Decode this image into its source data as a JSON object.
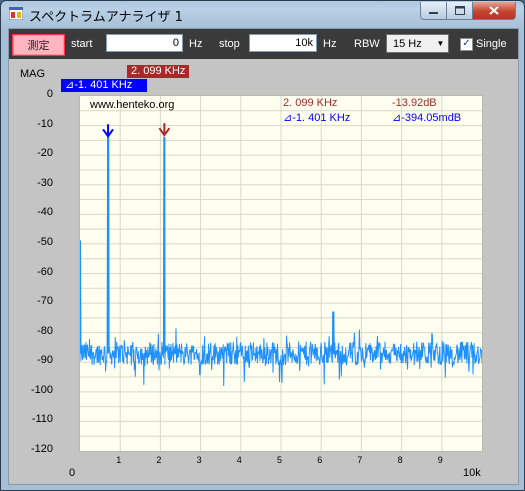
{
  "window": {
    "title": "スペクトラムアナライザ 1"
  },
  "toolbar": {
    "measure_label": "測定",
    "start_label": "start",
    "start_value": "0",
    "start_unit": "Hz",
    "stop_label": "stop",
    "stop_value": "10k",
    "stop_unit": "Hz",
    "rbw_label": "RBW",
    "rbw_selected": "15 Hz",
    "single_label": "Single",
    "single_checked": true
  },
  "plot": {
    "y_axis_label": "MAG",
    "marker1_readout": "2. 099 KHz",
    "marker2_readout": "⊿-1. 401 KHz",
    "watermark": "www.henteko.org",
    "marker1_freq": "2. 099 KHz",
    "marker1_level": "-13.92dB",
    "delta_freq": "⊿-1. 401 KHz",
    "delta_level": "⊿-394.05mdB",
    "x_start_label": "0",
    "x_end_label": "10k"
  },
  "colors": {
    "trace": "#1e90ff",
    "marker1": "#a52a2a",
    "marker2": "#0000ff",
    "grid": "#d8d8c8",
    "background": "#fffff0"
  },
  "chart_data": {
    "type": "line",
    "x_unit": "Hz",
    "xlim": [
      0,
      10000
    ],
    "ylim": [
      -120,
      0
    ],
    "ylabel": "MAG",
    "y_ticks": [
      "0",
      "-10",
      "-20",
      "-30",
      "-40",
      "-50",
      "-60",
      "-70",
      "-80",
      "-90",
      "-100",
      "-110",
      "-120"
    ],
    "x_ticks": [
      "1",
      "2",
      "3",
      "4",
      "5",
      "6",
      "7",
      "8",
      "9"
    ],
    "grid": true,
    "noise_floor_db": -87,
    "peaks": [
      {
        "x": 0,
        "y": -49
      },
      {
        "x": 700,
        "y": -14
      },
      {
        "x": 2099,
        "y": -14
      },
      {
        "x": 6300,
        "y": -73
      }
    ],
    "markers": [
      {
        "name": "marker1",
        "x": 2099,
        "y": -13.92
      },
      {
        "name": "marker2",
        "x": 698,
        "y": -14.3
      }
    ]
  }
}
